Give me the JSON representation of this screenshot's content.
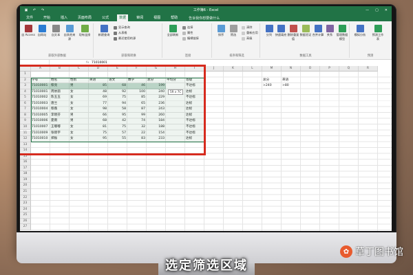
{
  "window": {
    "doc_title": "工作簿6 - Excel",
    "controls": [
      "—",
      "▢",
      "✕"
    ]
  },
  "menu_tabs": [
    "文件",
    "开始",
    "插入",
    "页面布局",
    "公式",
    "数据",
    "审阅",
    "视图",
    "帮助"
  ],
  "active_tab": "数据",
  "tell_me": "告诉我你想要做什么",
  "ribbon": {
    "groups": [
      {
        "label": "获取外部数据",
        "buttons": [
          "自 Access",
          "自网站",
          "自文本",
          "自其他来源",
          "现有连接"
        ]
      },
      {
        "label": "获取和转换",
        "buttons": [
          "新建查询"
        ],
        "small": [
          "显示查询",
          "从表格",
          "最近使用的源"
        ]
      },
      {
        "label": "连接",
        "buttons": [
          "全部刷新"
        ],
        "small": [
          "连接",
          "属性",
          "编辑链接"
        ]
      },
      {
        "label": "排序和筛选",
        "buttons": [
          "排序",
          "筛选"
        ],
        "small": [
          "清除",
          "重新应用",
          "高级"
        ]
      },
      {
        "label": "数据工具",
        "buttons": [
          "分列",
          "快速填充",
          "删除重复值",
          "数据验证",
          "合并计算",
          "关系",
          "管理数据模型"
        ]
      },
      {
        "label": "预测",
        "buttons": [
          "模拟分析",
          "预测工作表"
        ]
      }
    ]
  },
  "formula_bar": {
    "value": "71010001"
  },
  "columns": [
    "A",
    "B",
    "C",
    "D",
    "E",
    "F",
    "G",
    "H",
    "I",
    "J",
    "K",
    "L",
    "M",
    "N",
    "O",
    "P",
    "Q",
    "R"
  ],
  "row_numbers": [
    "1",
    "2",
    "3",
    "4",
    "5",
    "6",
    "7",
    "8",
    "9",
    "10",
    "11",
    "12",
    "13",
    "14",
    "15",
    "16",
    "17",
    "18",
    "19",
    "20",
    "21",
    "22",
    "23",
    "24",
    "25",
    "26",
    "27"
  ],
  "table": {
    "headers": [
      "学号",
      "姓名",
      "性别",
      "英语",
      "语文",
      "数学",
      "总分",
      "平均分",
      "等级"
    ],
    "rows": [
      [
        "71010001",
        "蔡亮",
        "男",
        "85",
        "68",
        "46",
        "199",
        "",
        "不达标"
      ],
      [
        "71010001",
        "周依丽",
        "女",
        "48",
        "92",
        "100",
        "240",
        "",
        "达标"
      ],
      [
        "71010002",
        "陈玉玉",
        "女",
        "69",
        "75",
        "85",
        "229",
        "",
        "不达标"
      ],
      [
        "71010003",
        "唐兰",
        "女",
        "77",
        "94",
        "65",
        "236",
        "",
        "达标"
      ],
      [
        "71010004",
        "蔡薇",
        "女",
        "98",
        "58",
        "87",
        "243",
        "",
        "达标"
      ],
      [
        "71010005",
        "李晓芬",
        "男",
        "66",
        "95",
        "99",
        "260",
        "",
        "达标"
      ],
      [
        "71010006",
        "夏雨",
        "男",
        "68",
        "42",
        "74",
        "184",
        "",
        "不达标"
      ],
      [
        "71010007",
        "王嘟嘟",
        "女",
        "81",
        "75",
        "32",
        "188",
        "",
        "不达标"
      ],
      [
        "71010009",
        "张晓宇",
        "女",
        "75",
        "57",
        "22",
        "154",
        "",
        "不达标"
      ],
      [
        "71010010",
        "郑振",
        "女",
        "95",
        "55",
        "83",
        "233",
        "",
        "达标"
      ]
    ]
  },
  "criteria": {
    "headers": [
      "总分",
      "英语"
    ],
    "values": [
      ">240",
      ">80"
    ]
  },
  "tooltip": "5R x 7C",
  "caption": "选定筛选区域",
  "watermark": "草丁图书馆",
  "colors": {
    "excel_green": "#217346",
    "highlight_red": "#d62b1e"
  }
}
